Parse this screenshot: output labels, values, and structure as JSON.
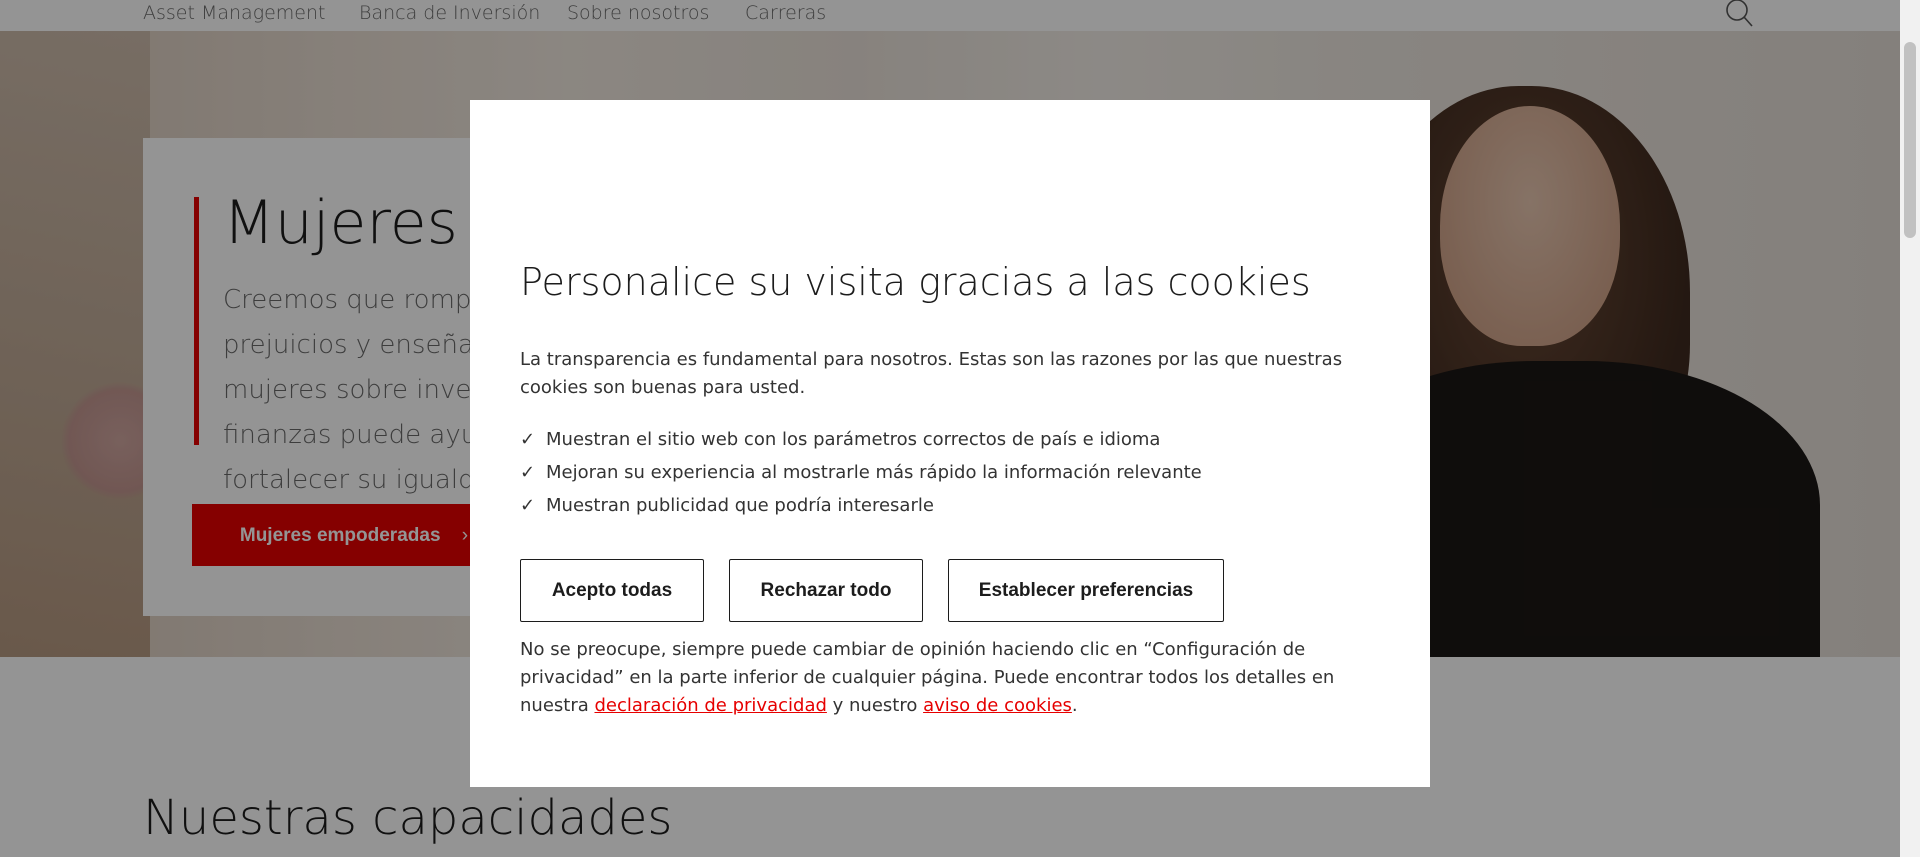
{
  "nav": {
    "items": [
      "Asset Management",
      "Banca de Inversión",
      "Sobre nosotros",
      "Carreras"
    ]
  },
  "hero": {
    "title": "Mujeres empoderadas",
    "text": "Creemos que romper los prejuicios y enseñar a las mujeres sobre inversiones y finanzas puede ayudarlas a fortalecer su igualdad financiera.",
    "button_label": "Mujeres empoderadas"
  },
  "section": {
    "title": "Nuestras capacidades"
  },
  "modal": {
    "title": "Personalice su visita gracias a las cookies",
    "intro": "La transparencia es fundamental para nosotros. Estas son las razones por las que nuestras cookies son buenas para usted.",
    "reasons": [
      "Muestran el sitio web con los parámetros correctos de país e idioma",
      "Mejoran su experiencia al mostrarle más rápido la información relevante",
      "Muestran publicidad que podría interesarle"
    ],
    "buttons": {
      "accept": "Acepto todas",
      "reject": "Rechazar todo",
      "preferences": "Establecer preferencias"
    },
    "footer": {
      "text_before": "No se preocupe, siempre puede cambiar de opinión haciendo clic en “Configuración de privacidad” en la parte inferior de cualquier página. Puede encontrar todos los detalles en nuestra ",
      "privacy_link": "declaración de privacidad",
      "text_middle": " y nuestro ",
      "cookies_link": "aviso de cookies",
      "text_after": "."
    }
  },
  "colors": {
    "brand_red": "#e60000",
    "overlay": "rgba(0,0,0,0.42)"
  },
  "icons": {
    "check": "✓",
    "chevron": "›"
  }
}
